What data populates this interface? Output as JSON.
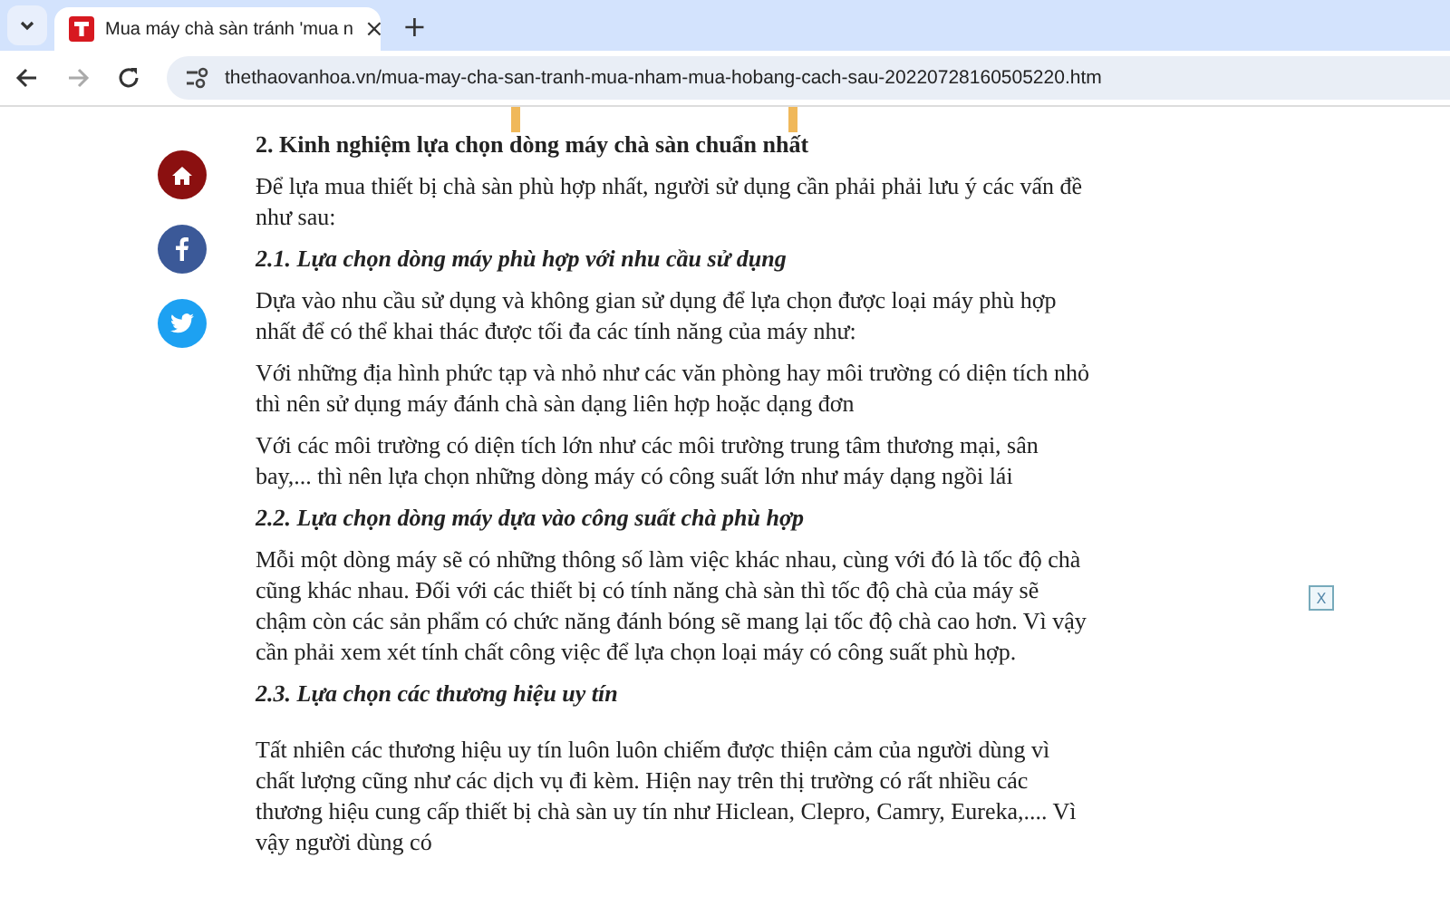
{
  "browser": {
    "tab": {
      "title": "Mua máy chà sàn tránh 'mua n",
      "selected": true,
      "close": "×"
    },
    "new_tab": "+",
    "url": "thethaovanhoa.vn/mua-may-cha-san-tranh-mua-nham-mua-hobang-cach-sau-20220728160505220.htm"
  },
  "share_buttons": [
    {
      "kind": "home",
      "color": "#8b1010"
    },
    {
      "kind": "facebook",
      "color": "#3b5998"
    },
    {
      "kind": "twitter",
      "color": "#1da1f2"
    }
  ],
  "article": [
    {
      "kind": "heading",
      "text": "2. Kinh nghiệm lựa chọn dòng máy chà sàn chuẩn nhất"
    },
    {
      "kind": "paragraph",
      "text": "Để lựa mua thiết bị chà sàn phù hợp nhất, người sử dụng cần phải phải lưu ý các vấn đề như sau:"
    },
    {
      "kind": "subheading",
      "text": "2.1. Lựa chọn dòng máy phù hợp với nhu cầu sử dụng"
    },
    {
      "kind": "paragraph",
      "text": "Dựa vào nhu cầu sử dụng và không gian sử dụng để lựa chọn được loại máy phù hợp nhất để có thể khai thác được tối đa các tính năng của máy như:"
    },
    {
      "kind": "paragraph",
      "text": "Với những địa hình phức tạp và nhỏ như các văn phòng hay môi trường có diện tích nhỏ thì nên sử dụng máy đánh chà sàn dạng liên hợp hoặc dạng đơn"
    },
    {
      "kind": "paragraph",
      "text": "Với các môi trường có diện tích lớn như các môi trường trung tâm thương mại, sân bay,... thì nên lựa chọn những dòng máy có công suất lớn như máy dạng ngồi lái"
    },
    {
      "kind": "subheading",
      "text": "2.2. Lựa chọn dòng máy dựa vào công suất chà phù hợp"
    },
    {
      "kind": "paragraph",
      "text": "Mỗi một dòng máy sẽ có những thông số làm việc khác nhau, cùng với đó là tốc độ chà cũng khác nhau. Đối với các thiết bị có tính năng chà sàn thì tốc độ chà của máy sẽ chậm còn các sản phẩm có chức năng đánh bóng sẽ mang lại tốc độ chà cao hơn. Vì vậy cần phải xem xét tính chất công việc để lựa chọn loại máy có công suất phù hợp."
    },
    {
      "kind": "subheading",
      "text": "2.3. Lựa chọn các thương hiệu uy tín"
    },
    {
      "kind": "paragraph",
      "text": "Tất nhiên các thương hiệu uy tín luôn luôn chiếm được thiện cảm của người dùng vì chất lượng cũng như các dịch vụ đi kèm. Hiện nay trên thị trường có rất nhiều các thương hiệu cung cấp thiết bị chà sàn uy tín như Hiclean, Clepro, Camry, Eureka,.... Vì vậy người dùng có"
    }
  ],
  "ad_close": "X"
}
